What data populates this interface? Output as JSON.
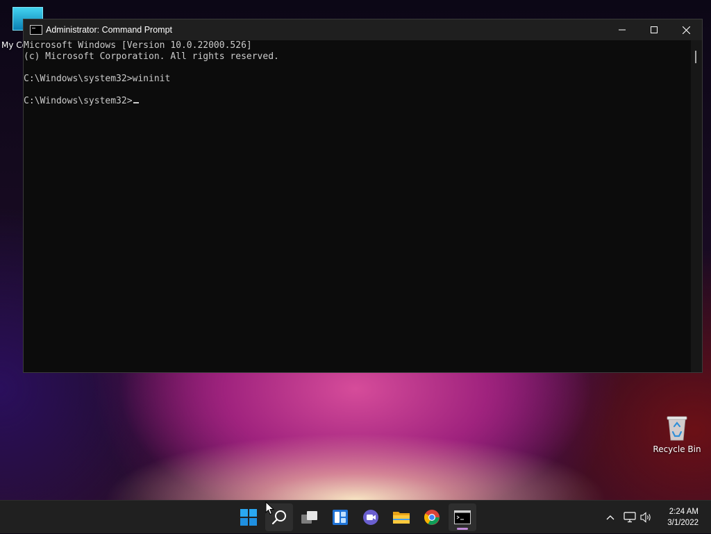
{
  "desktop": {
    "icons": [
      {
        "label": "My Co"
      },
      {
        "label": "Recycle Bin"
      }
    ]
  },
  "window": {
    "title": "Administrator: Command Prompt",
    "controls": {
      "minimize": "minimize-icon",
      "maximize": "maximize-icon",
      "close": "close-icon"
    }
  },
  "console": {
    "lines": [
      "Microsoft Windows [Version 10.0.22000.526]",
      "(c) Microsoft Corporation. All rights reserved.",
      "",
      "C:\\Windows\\system32>wininit",
      "",
      "C:\\Windows\\system32>"
    ]
  },
  "taskbar": {
    "apps": [
      {
        "name": "start",
        "icon": "windows-start-icon"
      },
      {
        "name": "search",
        "icon": "search-icon"
      },
      {
        "name": "task-view",
        "icon": "task-view-icon"
      },
      {
        "name": "widgets",
        "icon": "widgets-icon"
      },
      {
        "name": "chat",
        "icon": "teams-chat-icon"
      },
      {
        "name": "file-explorer",
        "icon": "folder-icon"
      },
      {
        "name": "chrome",
        "icon": "chrome-icon"
      },
      {
        "name": "command-prompt",
        "icon": "terminal-icon",
        "active": true
      }
    ],
    "tray": {
      "icons": [
        "chevron-up-icon",
        "network-icon",
        "volume-icon"
      ]
    },
    "clock": {
      "time": "2:24 AM",
      "date": "3/1/2022"
    }
  },
  "colors": {
    "console_bg": "#0c0c0c",
    "console_text": "#cccccc",
    "titlebar_bg": "#1f1f1f",
    "taskbar_bg": "#202020",
    "active_indicator": "#c08ad8"
  }
}
